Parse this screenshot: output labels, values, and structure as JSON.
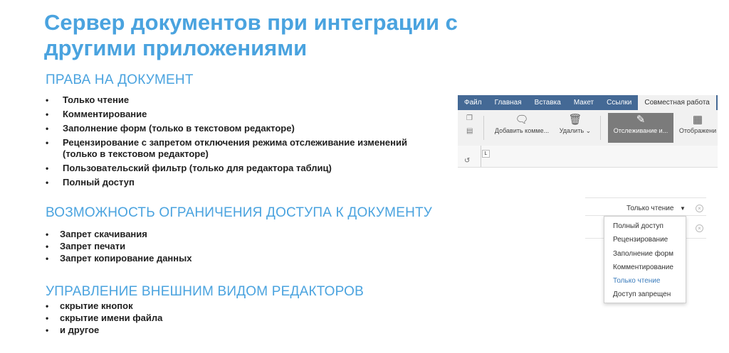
{
  "title": "Сервер документов при интеграции с другими приложениями",
  "sections": {
    "rights": {
      "heading": "ПРАВА НА ДОКУМЕНТ",
      "items": [
        "Только чтение",
        "Комментирование",
        "Заполнение форм (только в текстовом редакторе)",
        "Рецензирование с запретом отключения режима отслеживание изменений (только в текстовом редакторе)",
        "Пользовательский фильтр (только для редактора таблиц)",
        "Полный доступ"
      ]
    },
    "restrict": {
      "heading": "ВОЗМОЖНОСТЬ ОГРАНИЧЕНИЯ ДОСТУПА К ДОКУМЕНТУ",
      "items": [
        "Запрет скачивания",
        "Запрет печати",
        "Запрет копирование данных"
      ]
    },
    "appearance": {
      "heading": "УПРАВЛЕНИЕ ВНЕШНИМ ВИДОМ РЕДАКТОРОВ",
      "items": [
        "скрытие кнопок",
        "скрытие имени файла",
        "и другое"
      ]
    }
  },
  "toolbar": {
    "tabs": [
      "Файл",
      "Главная",
      "Вставка",
      "Макет",
      "Ссылки",
      "Совместная работа"
    ],
    "active_tab": "Совместная работа",
    "add_comment": "Добавить комме...",
    "delete": "Удалить",
    "track_changes": "Отслеживание и...",
    "display": "Отображени",
    "ruler_corner": "L"
  },
  "dropdown": {
    "current_value": "Только чтение",
    "options": [
      "Полный доступ",
      "Рецензирование",
      "Заполнение форм",
      "Комментирование",
      "Только чтение",
      "Доступ запрещен"
    ],
    "selected": "Только чтение"
  },
  "colors": {
    "accent": "#4aa3df",
    "tabbar": "#446995",
    "selected_option": "#3d7dbd"
  }
}
